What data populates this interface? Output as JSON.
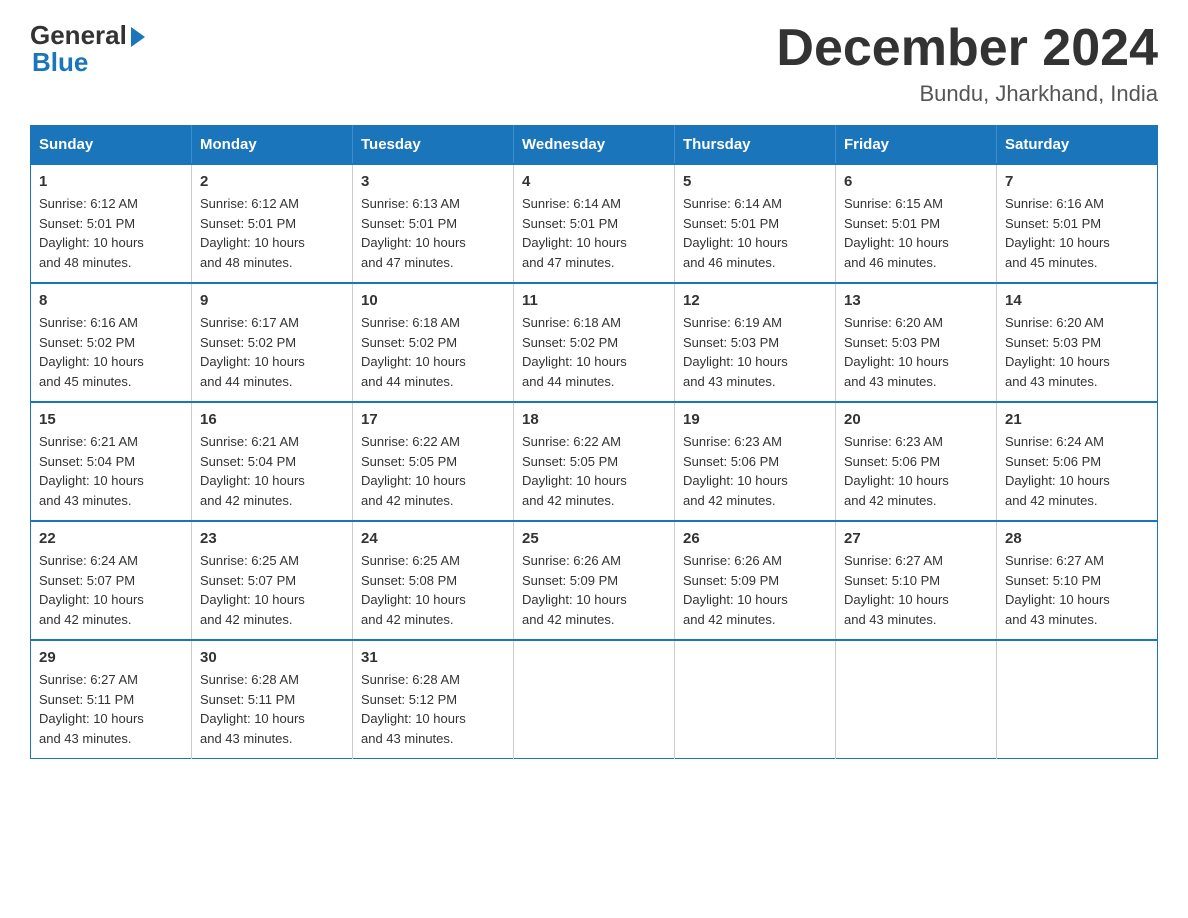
{
  "header": {
    "logo_general": "General",
    "logo_blue": "Blue",
    "month_title": "December 2024",
    "location": "Bundu, Jharkhand, India"
  },
  "days_of_week": [
    "Sunday",
    "Monday",
    "Tuesday",
    "Wednesday",
    "Thursday",
    "Friday",
    "Saturday"
  ],
  "weeks": [
    [
      {
        "day": "1",
        "sunrise": "6:12 AM",
        "sunset": "5:01 PM",
        "daylight": "10 hours and 48 minutes."
      },
      {
        "day": "2",
        "sunrise": "6:12 AM",
        "sunset": "5:01 PM",
        "daylight": "10 hours and 48 minutes."
      },
      {
        "day": "3",
        "sunrise": "6:13 AM",
        "sunset": "5:01 PM",
        "daylight": "10 hours and 47 minutes."
      },
      {
        "day": "4",
        "sunrise": "6:14 AM",
        "sunset": "5:01 PM",
        "daylight": "10 hours and 47 minutes."
      },
      {
        "day": "5",
        "sunrise": "6:14 AM",
        "sunset": "5:01 PM",
        "daylight": "10 hours and 46 minutes."
      },
      {
        "day": "6",
        "sunrise": "6:15 AM",
        "sunset": "5:01 PM",
        "daylight": "10 hours and 46 minutes."
      },
      {
        "day": "7",
        "sunrise": "6:16 AM",
        "sunset": "5:01 PM",
        "daylight": "10 hours and 45 minutes."
      }
    ],
    [
      {
        "day": "8",
        "sunrise": "6:16 AM",
        "sunset": "5:02 PM",
        "daylight": "10 hours and 45 minutes."
      },
      {
        "day": "9",
        "sunrise": "6:17 AM",
        "sunset": "5:02 PM",
        "daylight": "10 hours and 44 minutes."
      },
      {
        "day": "10",
        "sunrise": "6:18 AM",
        "sunset": "5:02 PM",
        "daylight": "10 hours and 44 minutes."
      },
      {
        "day": "11",
        "sunrise": "6:18 AM",
        "sunset": "5:02 PM",
        "daylight": "10 hours and 44 minutes."
      },
      {
        "day": "12",
        "sunrise": "6:19 AM",
        "sunset": "5:03 PM",
        "daylight": "10 hours and 43 minutes."
      },
      {
        "day": "13",
        "sunrise": "6:20 AM",
        "sunset": "5:03 PM",
        "daylight": "10 hours and 43 minutes."
      },
      {
        "day": "14",
        "sunrise": "6:20 AM",
        "sunset": "5:03 PM",
        "daylight": "10 hours and 43 minutes."
      }
    ],
    [
      {
        "day": "15",
        "sunrise": "6:21 AM",
        "sunset": "5:04 PM",
        "daylight": "10 hours and 43 minutes."
      },
      {
        "day": "16",
        "sunrise": "6:21 AM",
        "sunset": "5:04 PM",
        "daylight": "10 hours and 42 minutes."
      },
      {
        "day": "17",
        "sunrise": "6:22 AM",
        "sunset": "5:05 PM",
        "daylight": "10 hours and 42 minutes."
      },
      {
        "day": "18",
        "sunrise": "6:22 AM",
        "sunset": "5:05 PM",
        "daylight": "10 hours and 42 minutes."
      },
      {
        "day": "19",
        "sunrise": "6:23 AM",
        "sunset": "5:06 PM",
        "daylight": "10 hours and 42 minutes."
      },
      {
        "day": "20",
        "sunrise": "6:23 AM",
        "sunset": "5:06 PM",
        "daylight": "10 hours and 42 minutes."
      },
      {
        "day": "21",
        "sunrise": "6:24 AM",
        "sunset": "5:06 PM",
        "daylight": "10 hours and 42 minutes."
      }
    ],
    [
      {
        "day": "22",
        "sunrise": "6:24 AM",
        "sunset": "5:07 PM",
        "daylight": "10 hours and 42 minutes."
      },
      {
        "day": "23",
        "sunrise": "6:25 AM",
        "sunset": "5:07 PM",
        "daylight": "10 hours and 42 minutes."
      },
      {
        "day": "24",
        "sunrise": "6:25 AM",
        "sunset": "5:08 PM",
        "daylight": "10 hours and 42 minutes."
      },
      {
        "day": "25",
        "sunrise": "6:26 AM",
        "sunset": "5:09 PM",
        "daylight": "10 hours and 42 minutes."
      },
      {
        "day": "26",
        "sunrise": "6:26 AM",
        "sunset": "5:09 PM",
        "daylight": "10 hours and 42 minutes."
      },
      {
        "day": "27",
        "sunrise": "6:27 AM",
        "sunset": "5:10 PM",
        "daylight": "10 hours and 43 minutes."
      },
      {
        "day": "28",
        "sunrise": "6:27 AM",
        "sunset": "5:10 PM",
        "daylight": "10 hours and 43 minutes."
      }
    ],
    [
      {
        "day": "29",
        "sunrise": "6:27 AM",
        "sunset": "5:11 PM",
        "daylight": "10 hours and 43 minutes."
      },
      {
        "day": "30",
        "sunrise": "6:28 AM",
        "sunset": "5:11 PM",
        "daylight": "10 hours and 43 minutes."
      },
      {
        "day": "31",
        "sunrise": "6:28 AM",
        "sunset": "5:12 PM",
        "daylight": "10 hours and 43 minutes."
      },
      null,
      null,
      null,
      null
    ]
  ],
  "labels": {
    "sunrise": "Sunrise:",
    "sunset": "Sunset:",
    "daylight": "Daylight:"
  }
}
